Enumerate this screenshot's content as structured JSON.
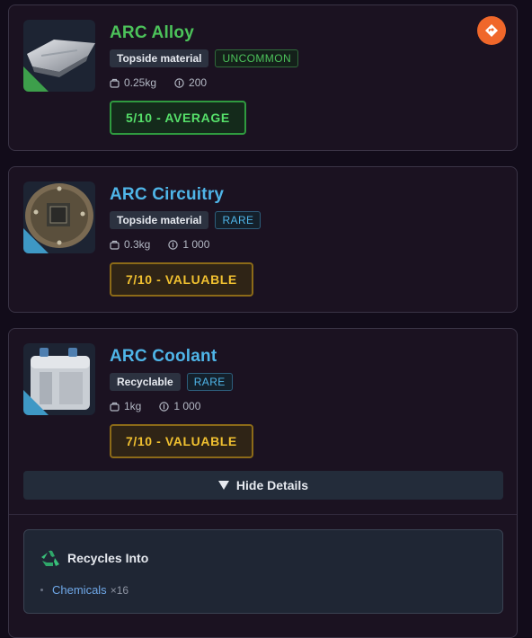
{
  "items": [
    {
      "name": "ARC Alloy",
      "type": "Topside material",
      "rarity": "UNCOMMON",
      "weight": "0.25kg",
      "value": "200",
      "score": "5/10 - AVERAGE",
      "colors": {
        "title": "#4cc25a",
        "rarity": "#3f9e4c",
        "score_text": "#56e06a",
        "score_border": "#2f9a3f",
        "score_bg": "#142a1b",
        "corner": "#3d9f4b"
      },
      "icon": "metal-plate-icon"
    },
    {
      "name": "ARC Circuitry",
      "type": "Topside material",
      "rarity": "RARE",
      "weight": "0.3kg",
      "value": "1 000",
      "score": "7/10 - VALUABLE",
      "colors": {
        "title": "#4fb5e8",
        "rarity": "#46a6d4",
        "score_text": "#f0c030",
        "score_border": "#8c6a18",
        "score_bg": "#2f2416",
        "corner": "#3e98c5"
      },
      "icon": "circuit-board-icon"
    },
    {
      "name": "ARC Coolant",
      "type": "Recyclable",
      "rarity": "RARE",
      "weight": "1kg",
      "value": "1 000",
      "score": "7/10 - VALUABLE",
      "colors": {
        "title": "#4fb5e8",
        "rarity": "#46a6d4",
        "score_text": "#f0c030",
        "score_border": "#8c6a18",
        "score_bg": "#2f2416",
        "corner": "#3e98c5"
      },
      "icon": "coolant-canister-icon"
    }
  ],
  "details": {
    "toggle_label": "Hide Details",
    "toggle_icon": "triangle-down-icon",
    "recycles_title": "Recycles Into",
    "recycles_icon": "recycle-icon",
    "recycles": [
      {
        "name": "Chemicals",
        "qty": "×16"
      }
    ]
  },
  "badge_icon": "map-pin-icon",
  "badge_color": "#f0672a"
}
